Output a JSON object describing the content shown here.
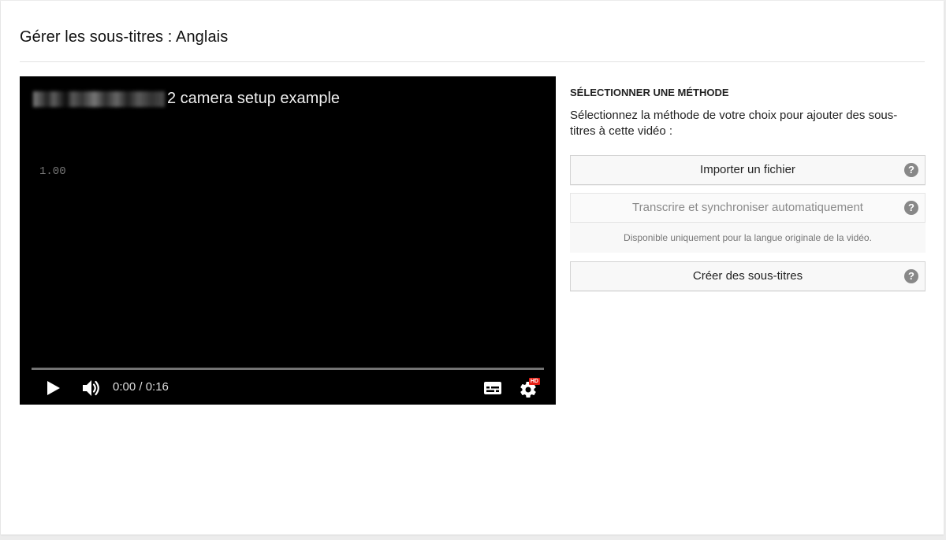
{
  "page": {
    "title": "Gérer les sous-titres : Anglais"
  },
  "player": {
    "video_title": "2 camera setup example",
    "caption_overlay": "1.00",
    "time": "0:00 / 0:16",
    "progress_fraction": 0,
    "hd_badge": "HD",
    "accent_color": "#ff0000"
  },
  "method": {
    "heading": "SÉLECTIONNER UNE MÉTHODE",
    "description": "Sélectionnez la méthode de votre choix pour ajouter des sous-titres à cette vidéo :",
    "options": [
      {
        "label": "Importer un fichier",
        "help": "?",
        "enabled": true
      },
      {
        "label": "Transcrire et synchroniser automatiquement",
        "help": "?",
        "enabled": false
      },
      {
        "label": "Créer des sous-titres",
        "help": "?",
        "enabled": true
      }
    ],
    "auto_note": "Disponible uniquement pour la langue originale de la vidéo."
  },
  "icons": {
    "play": "play-icon",
    "volume": "volume-icon",
    "subtitles": "subtitles-icon",
    "settings": "settings-gear-icon",
    "help": "help-icon"
  }
}
